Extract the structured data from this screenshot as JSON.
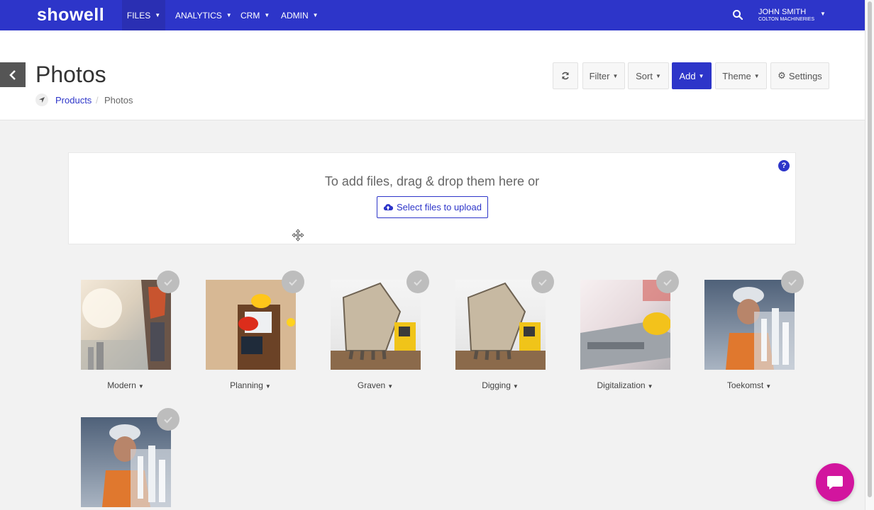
{
  "nav": {
    "logo": "showell",
    "items": [
      {
        "label": "FILES"
      },
      {
        "label": "ANALYTICS"
      },
      {
        "label": "CRM"
      },
      {
        "label": "ADMIN"
      }
    ],
    "user_name": "JOHN SMITH",
    "user_company": "COLTON MACHINERIES"
  },
  "header": {
    "title": "Photos",
    "breadcrumb": {
      "link": "Products",
      "separator": "/",
      "current": "Photos"
    }
  },
  "toolbar": {
    "filter": "Filter",
    "sort": "Sort",
    "add": "Add",
    "theme": "Theme",
    "settings": "Settings"
  },
  "upload": {
    "prompt": "To add files, drag & drop them here or",
    "button": "Select files to upload",
    "help": "?"
  },
  "gallery": [
    {
      "name": "Modern"
    },
    {
      "name": "Planning"
    },
    {
      "name": "Graven"
    },
    {
      "name": "Digging"
    },
    {
      "name": "Digitalization"
    },
    {
      "name": "Toekomst"
    },
    {
      "name": ""
    }
  ],
  "colors": {
    "brand": "#2d35c9",
    "chat": "#d2159e"
  },
  "icons": [
    "search-icon",
    "chevron-left-icon",
    "navigation-arrow-icon",
    "refresh-icon",
    "gear-icon",
    "cloud-upload-icon",
    "question-icon",
    "move-cursor-icon",
    "check-icon",
    "chat-icon"
  ]
}
